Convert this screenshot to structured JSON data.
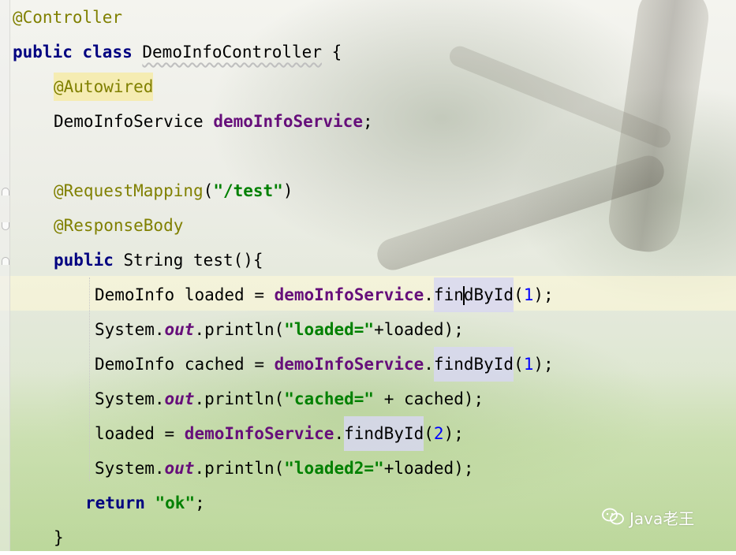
{
  "code": {
    "class_annotation": "@Controller",
    "kw_public": "public",
    "kw_class": "class",
    "kw_return": "return",
    "class_name": "DemoInfoController",
    "open_brace": " {",
    "field_annotation": "@Autowired",
    "field_type": "DemoInfoService",
    "field_name": "demoInfoService",
    "semicolon": ";",
    "mapping_annotation": "@RequestMapping",
    "mapping_path": "\"/test\"",
    "body_annotation": "@ResponseBody",
    "method_return_type": "String",
    "method_sig": "test(){",
    "demoinfo_type": "DemoInfo",
    "var_loaded": "loaded",
    "var_cached": "cached",
    "eq": " = ",
    "dot": ".",
    "method_find": "findById",
    "arg_1": "1",
    "arg_2": "2",
    "system": "System",
    "out": "out",
    "println": "println(",
    "str_loaded": "\"loaded=\"",
    "str_cached": "\"cached=\"",
    "str_loaded2": "\"loaded2=\"",
    "plus_loaded": "+loaded);",
    "plus_cached": " + cached);",
    "str_ok": "\"ok\"",
    "close_brace": "}"
  },
  "watermark": {
    "text": "Java老王",
    "icon": "wechat-chat-icon"
  },
  "colors": {
    "keyword": "#000080",
    "annotation": "#808000",
    "field": "#660e7a",
    "string": "#008000",
    "number": "#0000ff"
  }
}
